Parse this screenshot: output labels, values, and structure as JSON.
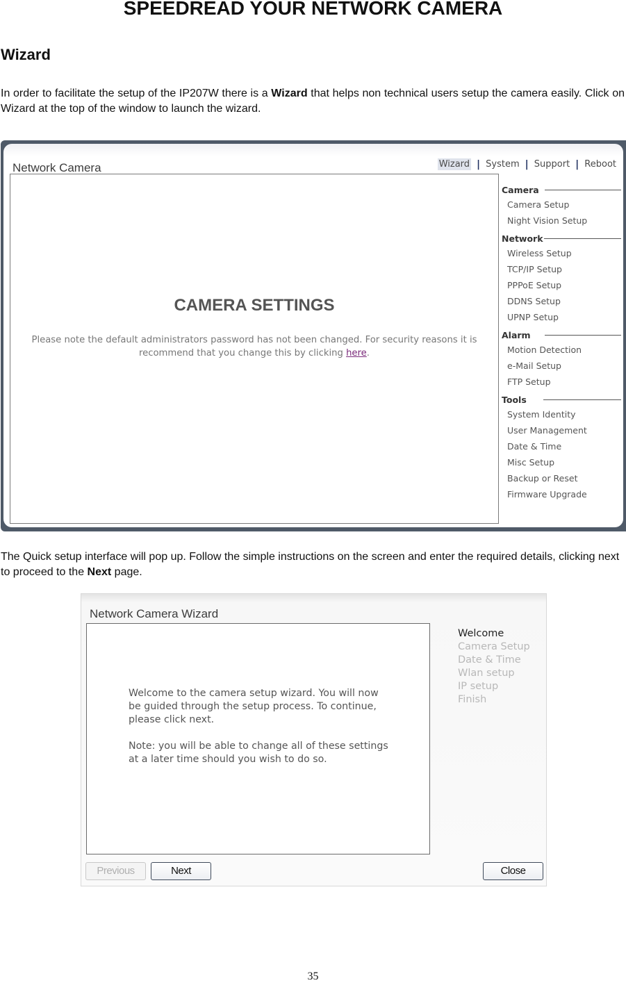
{
  "document": {
    "title": "SPEEDREAD YOUR NETWORK CAMERA",
    "section_heading": "Wizard",
    "paragraph1": {
      "before": "In order to facilitate the setup of the IP207W there is a ",
      "bold": "Wizard",
      "after": " that helps non technical users setup the camera easily. Click on Wizard at the top of the window to launch the wizard."
    },
    "paragraph2": {
      "before": "The Quick setup interface will pop up. Follow the simple instructions on the screen and enter the required details, clicking next to proceed to the ",
      "bold": "Next",
      "after": " page."
    },
    "page_number": "35"
  },
  "camera_screenshot": {
    "app_title": "Network Camera",
    "top_nav": [
      {
        "label": "Wizard",
        "active": true
      },
      {
        "label": "System",
        "active": false
      },
      {
        "label": "Support",
        "active": false
      },
      {
        "label": "Reboot",
        "active": false
      }
    ],
    "nav_separator": "|",
    "main": {
      "heading": "CAMERA SETTINGS",
      "notice_before": "Please note the default administrators password has not been changed. For security reasons it is recommend that you change this by clicking ",
      "notice_link": "here",
      "notice_after": "."
    },
    "sidebar": [
      {
        "heading": "Camera",
        "items": [
          "Camera Setup",
          "Night Vision Setup"
        ]
      },
      {
        "heading": "Network",
        "items": [
          "Wireless Setup",
          "TCP/IP Setup",
          "PPPoE Setup",
          "DDNS Setup",
          "UPNP Setup"
        ]
      },
      {
        "heading": "Alarm",
        "items": [
          "Motion Detection",
          "e-Mail Setup",
          "FTP Setup"
        ]
      },
      {
        "heading": "Tools",
        "items": [
          "System Identity",
          "User Management",
          "Date & Time",
          "Misc Setup",
          "Backup or Reset",
          "Firmware Upgrade"
        ]
      }
    ]
  },
  "wizard_screenshot": {
    "title": "Network Camera Wizard",
    "body_paragraphs": [
      "Welcome to the camera setup wizard. You will now be guided through the setup process. To continue, please click next.",
      "Note: you will be able to change all of these settings at a later time should you wish to do so."
    ],
    "steps": [
      {
        "label": "Welcome",
        "current": true
      },
      {
        "label": "Camera Setup",
        "current": false
      },
      {
        "label": "Date & Time",
        "current": false
      },
      {
        "label": "Wlan setup",
        "current": false
      },
      {
        "label": "IP setup",
        "current": false
      },
      {
        "label": "Finish",
        "current": false
      }
    ],
    "buttons": {
      "previous": {
        "label": "Previous",
        "enabled": false
      },
      "next": {
        "label": "Next",
        "enabled": true
      },
      "close": {
        "label": "Close",
        "enabled": true
      }
    }
  }
}
